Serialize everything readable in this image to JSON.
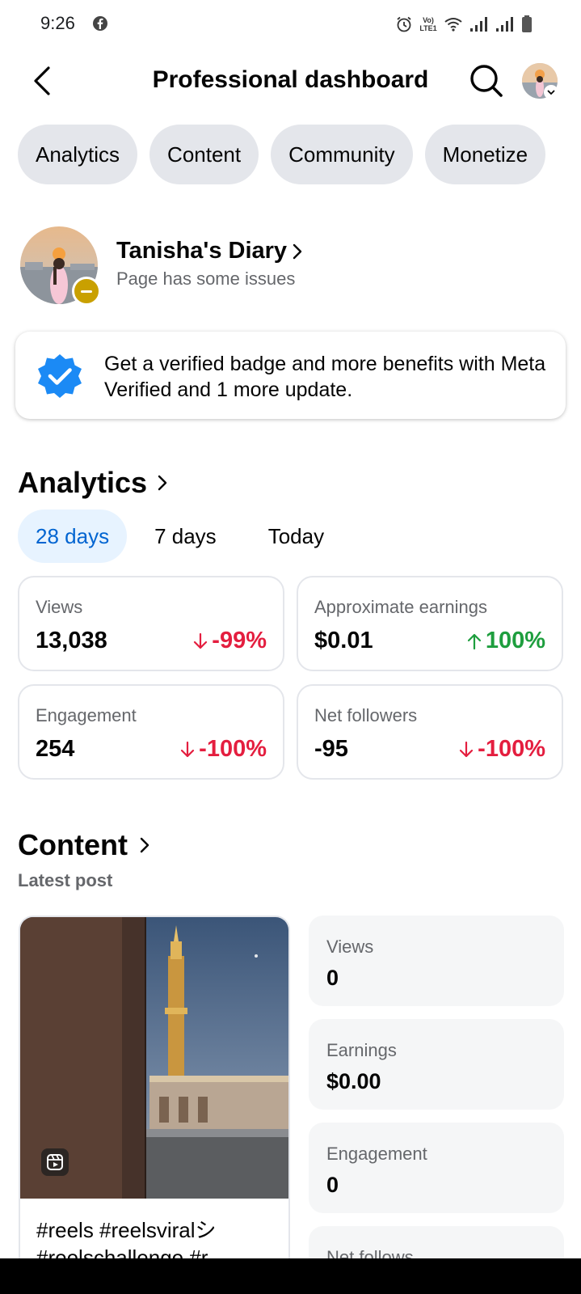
{
  "status_bar": {
    "time": "9:26",
    "network_label": "Vo) LTE1"
  },
  "header": {
    "title": "Professional dashboard"
  },
  "tabs": [
    {
      "label": "Analytics"
    },
    {
      "label": "Content"
    },
    {
      "label": "Community"
    },
    {
      "label": "Monetize"
    }
  ],
  "profile": {
    "name": "Tanisha's Diary",
    "status": "Page has some issues"
  },
  "promo": {
    "text": "Get a verified badge and more benefits with Meta Verified and 1 more update."
  },
  "analytics": {
    "title": "Analytics",
    "ranges": [
      "28 days",
      "7 days",
      "Today"
    ],
    "active_range": "28 days",
    "stats": [
      {
        "label": "Views",
        "value": "13,038",
        "change": "-99%",
        "direction": "down"
      },
      {
        "label": "Approximate earnings",
        "value": "$0.01",
        "change": "100%",
        "direction": "up"
      },
      {
        "label": "Engagement",
        "value": "254",
        "change": "-100%",
        "direction": "down"
      },
      {
        "label": "Net followers",
        "value": "-95",
        "change": "-100%",
        "direction": "down"
      }
    ]
  },
  "content": {
    "title": "Content",
    "subtitle": "Latest post",
    "post": {
      "caption": "#reels #reelsviralシ #reelschallenge #r"
    },
    "metrics": [
      {
        "label": "Views",
        "value": "0"
      },
      {
        "label": "Earnings",
        "value": "$0.00"
      },
      {
        "label": "Engagement",
        "value": "0"
      },
      {
        "label": "Net follows",
        "value": ""
      }
    ]
  },
  "colors": {
    "accent": "#0064d1",
    "accent_bg": "#e7f3ff",
    "chip_bg": "#e4e6eb",
    "negative": "#e41e3f",
    "positive": "#1e9e3e",
    "badge": "#c9a000",
    "verified": "#1b8af5"
  },
  "icons": [
    "back-arrow-icon",
    "search-icon",
    "chevron-right-icon",
    "verified-badge-icon",
    "reel-icon",
    "arrow-down-icon",
    "arrow-up-icon"
  ]
}
